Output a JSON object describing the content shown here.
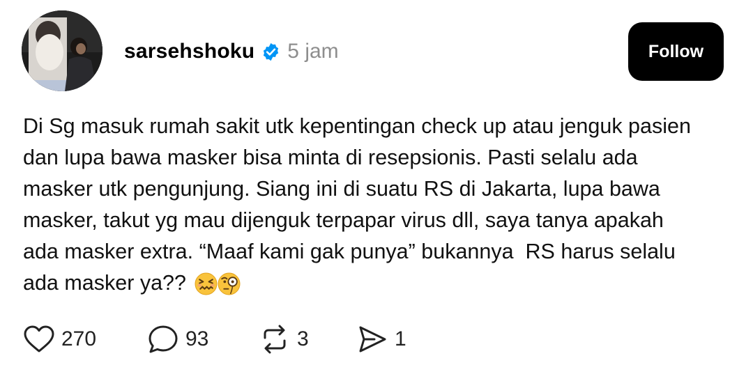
{
  "post": {
    "author": {
      "username": "sarsehshoku",
      "verified_icon": "verified-badge-icon",
      "avatar_icon": "profile-avatar"
    },
    "timestamp": "5 jam",
    "follow_label": "Follow",
    "text": "Di Sg masuk rumah sakit utk kepentingan check up atau jenguk pasien\ndan lupa bawa masker bisa minta di resepsionis. Pasti selalu ada\nmasker utk pengunjung. Siang ini di suatu RS di Jakarta, lupa bawa\nmasker, takut yg mau dijenguk terpapar virus dll, saya tanya apakah\nada masker extra. “Maaf kami gak punya” bukannya  RS harus selalu\nada masker ya??",
    "emojis": [
      "confounded-face-emoji",
      "face-with-monocle-emoji"
    ],
    "actions": {
      "likes": "270",
      "comments": "93",
      "reposts": "3",
      "shares": "1"
    }
  },
  "colors": {
    "verified_blue": "#0095f6",
    "timestamp_gray": "#8e8e8e",
    "button_black": "#000000"
  }
}
